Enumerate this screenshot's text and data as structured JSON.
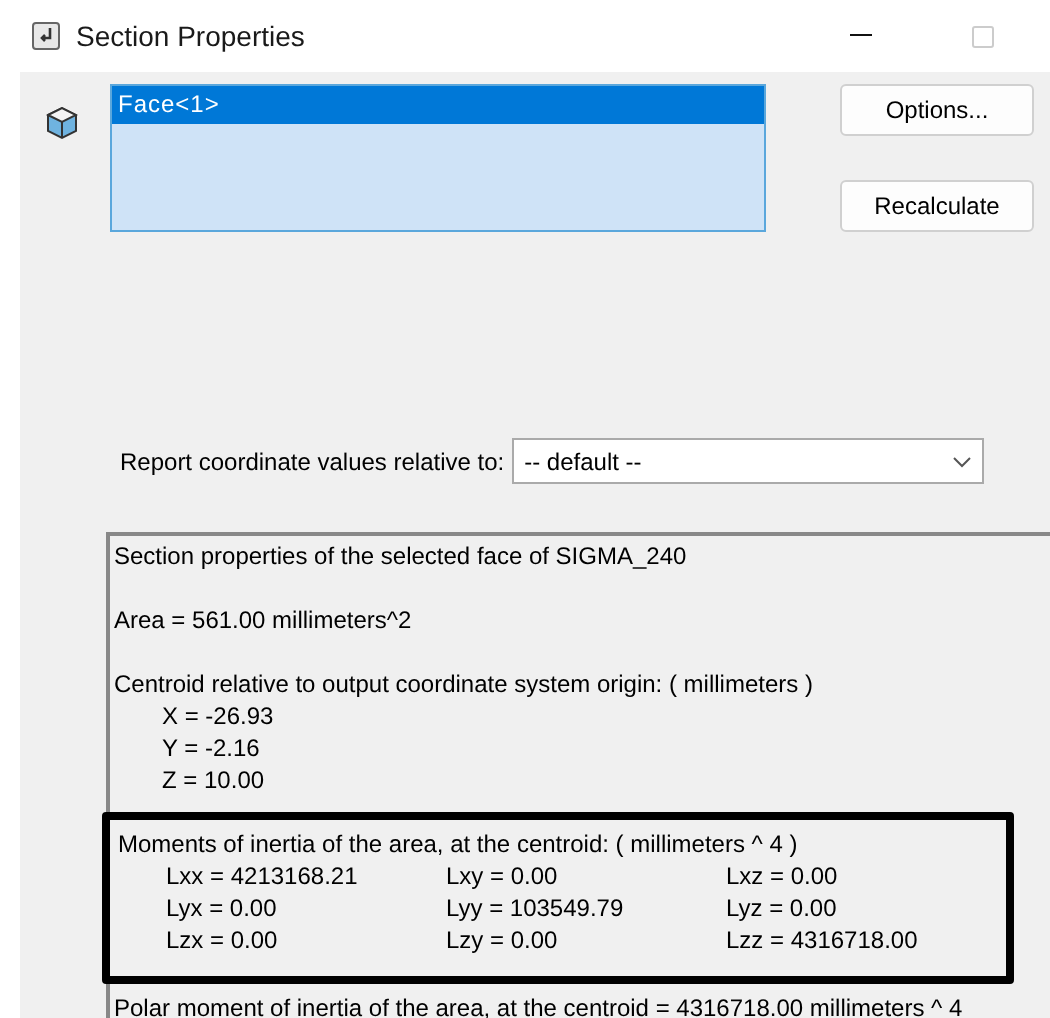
{
  "window": {
    "title": "Section Properties"
  },
  "selection_list": {
    "items": [
      {
        "label": "Face<1>",
        "selected": true
      }
    ]
  },
  "buttons": [
    {
      "label": "Options..."
    },
    {
      "label": "Recalculate"
    }
  ],
  "coordinate_system": {
    "label": "Report coordinate values relative to:",
    "value": "-- default --"
  },
  "report": {
    "heading": "Section properties of the selected face of SIGMA_240",
    "area": "Area = 561.00 millimeters^2",
    "centroid": {
      "title": "Centroid relative to output coordinate system origin: ( millimeters )",
      "values": [
        "X = -26.93",
        "Y = -2.16",
        "Z = 10.00"
      ]
    },
    "moments": {
      "highlighted": true,
      "title": "Moments of inertia of the area, at the centroid: ( millimeters ^ 4 )",
      "rows": [
        [
          "Lxx = 4213168.21",
          "Lxy = 0.00",
          "Lxz = 0.00"
        ],
        [
          "Lyx = 0.00",
          "Lyy = 103549.79",
          "Lyz = 0.00"
        ],
        [
          "Lzx = 0.00",
          "Lzy = 0.00",
          "Lzz = 4316718.00"
        ]
      ]
    },
    "polar": "Polar moment of inertia of the area, at the centroid = 4316718.00 millimeters ^ 4"
  }
}
